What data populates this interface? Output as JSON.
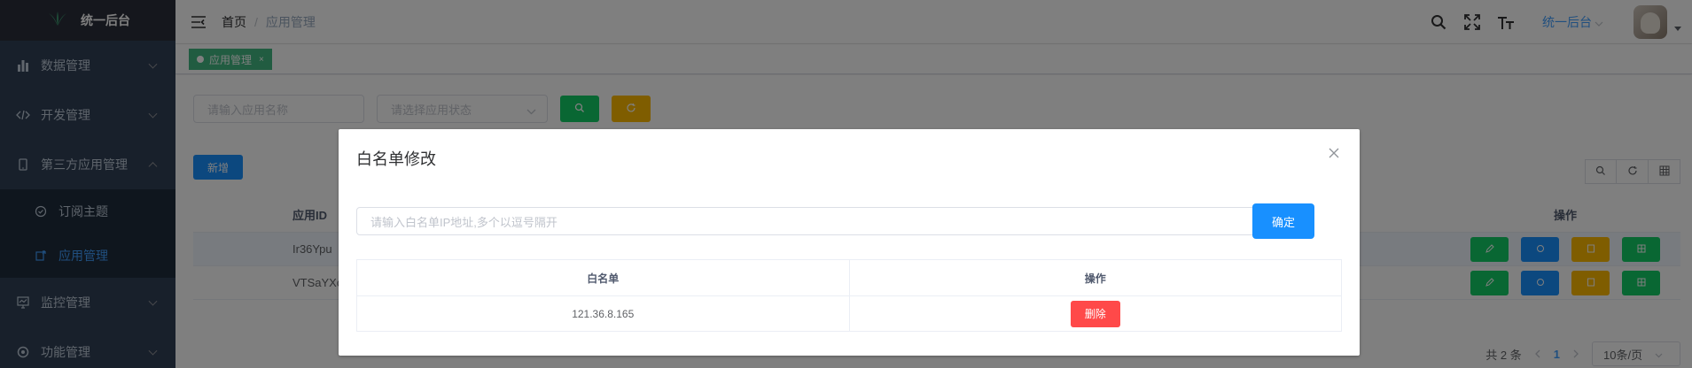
{
  "app": {
    "title": "统一后台"
  },
  "sidebar": {
    "items": [
      {
        "label": "数据管理",
        "icon": "bar-chart-icon"
      },
      {
        "label": "开发管理",
        "icon": "code-icon"
      },
      {
        "label": "第三方应用管理",
        "icon": "mobile-icon",
        "expanded": true,
        "children": [
          {
            "label": "订阅主题",
            "icon": "subscribe-icon"
          },
          {
            "label": "应用管理",
            "icon": "app-manage-icon",
            "active": true
          }
        ]
      },
      {
        "label": "监控管理",
        "icon": "monitor-icon"
      },
      {
        "label": "功能管理",
        "icon": "function-icon"
      }
    ]
  },
  "header": {
    "breadcrumb": {
      "home": "首页",
      "separator": "/",
      "current": "应用管理"
    },
    "system_select": "统一后台"
  },
  "tags": {
    "active": "应用管理"
  },
  "filters": {
    "app_name_placeholder": "请输入应用名称",
    "app_status_placeholder": "请选择应用状态"
  },
  "toolbar": {
    "add_label": "新增"
  },
  "table": {
    "columns": {
      "app_id": "应用ID",
      "ops": "操作"
    },
    "rows": [
      {
        "app_id": "Ir36Ypu"
      },
      {
        "app_id": "VTSaYXc"
      }
    ]
  },
  "pagination": {
    "total": "共 2 条",
    "current": "1",
    "page_size": "10条/页"
  },
  "dialog": {
    "title": "白名单修改",
    "ip_placeholder": "请输入白名单IP地址,多个以逗号隔开",
    "confirm_label": "确定",
    "columns": {
      "whitelist": "白名单",
      "ops": "操作"
    },
    "rows": [
      {
        "ip": "121.36.8.165",
        "delete_label": "删除"
      }
    ]
  },
  "colors": {
    "sidebar_bg": "#304156",
    "active": "#409eff",
    "success": "#13ce66",
    "warning": "#ffba00",
    "primary": "#1890ff",
    "danger": "#ff4949"
  }
}
